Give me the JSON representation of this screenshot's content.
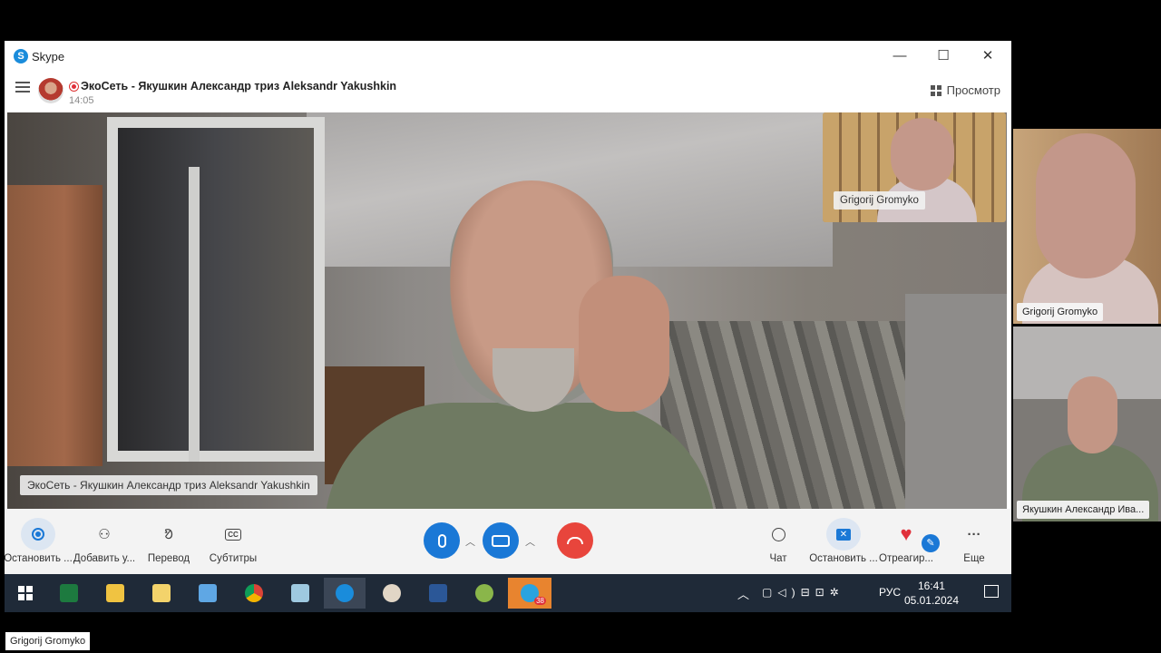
{
  "window": {
    "app_title": "Skype",
    "controls": {
      "minimize": "—",
      "maximize": "☐",
      "close": "✕"
    }
  },
  "call_header": {
    "title": "ЭкоСеть - Якушкин Александр триз Aleksandr Yakushkin",
    "time": "14:05",
    "view_label": "Просмотр"
  },
  "main_video": {
    "name_label": "ЭкоСеть - Якушкин Александр триз Aleksandr Yakushkin"
  },
  "pip_video": {
    "name_label": "Grigorij Gromyko"
  },
  "controls": {
    "left": [
      {
        "label": "Остановить ...",
        "icon": "record-icon"
      },
      {
        "label": "Добавить у...",
        "icon": "add-person-icon"
      },
      {
        "label": "Перевод",
        "icon": "translate-icon"
      },
      {
        "label": "Субтитры",
        "icon": "cc-icon"
      }
    ],
    "right": [
      {
        "label": "Чат",
        "icon": "chat-icon"
      },
      {
        "label": "Остановить ...",
        "icon": "stop-share-icon"
      },
      {
        "label": "Отреагир...",
        "icon": "heart-icon"
      },
      {
        "label": "Еще",
        "icon": "more-icon"
      }
    ],
    "center": {
      "mic_icon": "microphone-icon",
      "camera_icon": "camera-icon",
      "hangup_icon": "hangup-icon"
    },
    "accent_color": "#1a78d6",
    "hangup_color": "#e8453c"
  },
  "taskbar": {
    "apps": [
      "windows-start-icon",
      "excel-icon",
      "file-explorer-icon",
      "notepad-icon",
      "remote-desktop-icon",
      "chrome-icon",
      "notes-icon",
      "skype-icon",
      "paint-icon",
      "word-icon",
      "game-icon",
      "telegram-icon"
    ],
    "telegram_badge": "38",
    "language": "РУС",
    "time": "16:41",
    "date": "05.01.2024"
  },
  "side_participants": [
    {
      "name": "Grigorij Gromyko"
    },
    {
      "name": "Якушкин Александр Ива..."
    }
  ],
  "bottom_label": "Grigorij Gromyko"
}
